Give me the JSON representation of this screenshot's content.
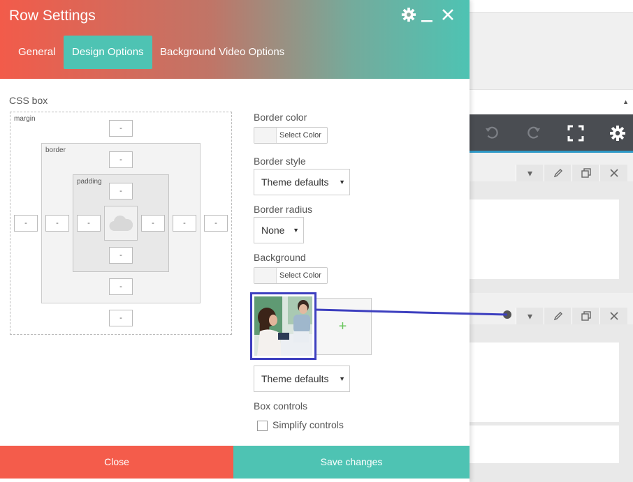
{
  "modal": {
    "title": "Row Settings",
    "tabs": [
      {
        "label": "General",
        "active": false
      },
      {
        "label": "Design Options",
        "active": true
      },
      {
        "label": "Background Video Options",
        "active": false
      }
    ],
    "header_icons": [
      "gear-icon",
      "minimize-icon",
      "close-icon"
    ]
  },
  "css_box": {
    "title": "CSS box",
    "margin_label": "margin",
    "border_label": "border",
    "padding_label": "padding",
    "margin": {
      "top": "-",
      "right": "-",
      "bottom": "-",
      "left": "-"
    },
    "border": {
      "top": "-",
      "right": "-",
      "bottom": "-",
      "left": "-"
    },
    "padding": {
      "top": "-",
      "right": "-",
      "bottom": "-",
      "left": "-"
    }
  },
  "design": {
    "border_color": {
      "label": "Border color",
      "button": "Select Color"
    },
    "border_style": {
      "label": "Border style",
      "value": "Theme defaults"
    },
    "border_radius": {
      "label": "Border radius",
      "value": "None"
    },
    "background": {
      "label": "Background",
      "button": "Select Color",
      "add_image_symbol": "+",
      "image_style": "Theme defaults"
    },
    "box_controls": {
      "label": "Box controls",
      "checkbox_label": "Simplify controls",
      "checked": false
    }
  },
  "footer": {
    "close": "Close",
    "save": "Save changes"
  },
  "colors": {
    "header_start": "#f25b4a",
    "header_end": "#4ec3b3",
    "accent_teal": "#4ec3b3",
    "close_red": "#f45c4b",
    "highlight_blue": "#3d3fbf",
    "toolbar_dark": "#4a4d52"
  },
  "editor": {
    "toolbar_icons": [
      "undo-icon",
      "redo-icon",
      "fullscreen-icon",
      "settings-icon"
    ],
    "element_controls": [
      "chevron-down-icon",
      "pencil-icon",
      "clone-icon",
      "close-icon"
    ]
  }
}
